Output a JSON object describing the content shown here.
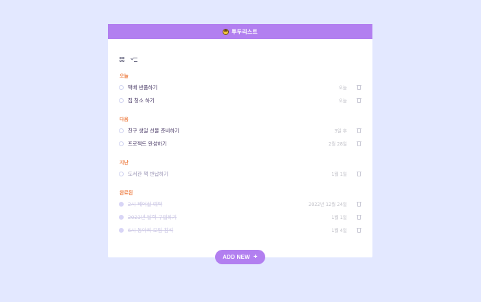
{
  "app": {
    "title": "투두리스트"
  },
  "colors": {
    "background": "#e3e8ff",
    "accent": "#b27ff0",
    "section": "#ef8a55",
    "text": "#4c3d69",
    "muted": "#c1c1c8"
  },
  "toolbar": {
    "view_icons": [
      "grid-view-icon",
      "checklist-view-icon"
    ]
  },
  "sections": {
    "today": {
      "title": "오늘",
      "items": [
        {
          "title": "택배 반품하기",
          "date": "오늘",
          "done": false
        },
        {
          "title": "집 청소 하기",
          "date": "오늘",
          "done": false
        }
      ]
    },
    "next": {
      "title": "다음",
      "items": [
        {
          "title": "친구 생일 선물 준비하기",
          "date": "3일 후",
          "done": false
        },
        {
          "title": "프로젝트 완성하기",
          "date": "2월 28일",
          "done": false
        }
      ]
    },
    "past": {
      "title": "지난",
      "items": [
        {
          "title": "도서관 책 반납하기",
          "date": "1월 1일",
          "done": false
        }
      ]
    },
    "done": {
      "title": "완료된",
      "items": [
        {
          "title": "2시 헤어샵 예약",
          "date": "2022년 12월 24일",
          "done": true
        },
        {
          "title": "2023년 달력 구입하기",
          "date": "1월 1일",
          "done": true
        },
        {
          "title": "6시 동아리 모임 참석",
          "date": "1월 4일",
          "done": true
        }
      ]
    }
  },
  "actions": {
    "add_new_label": "ADD NEW"
  }
}
